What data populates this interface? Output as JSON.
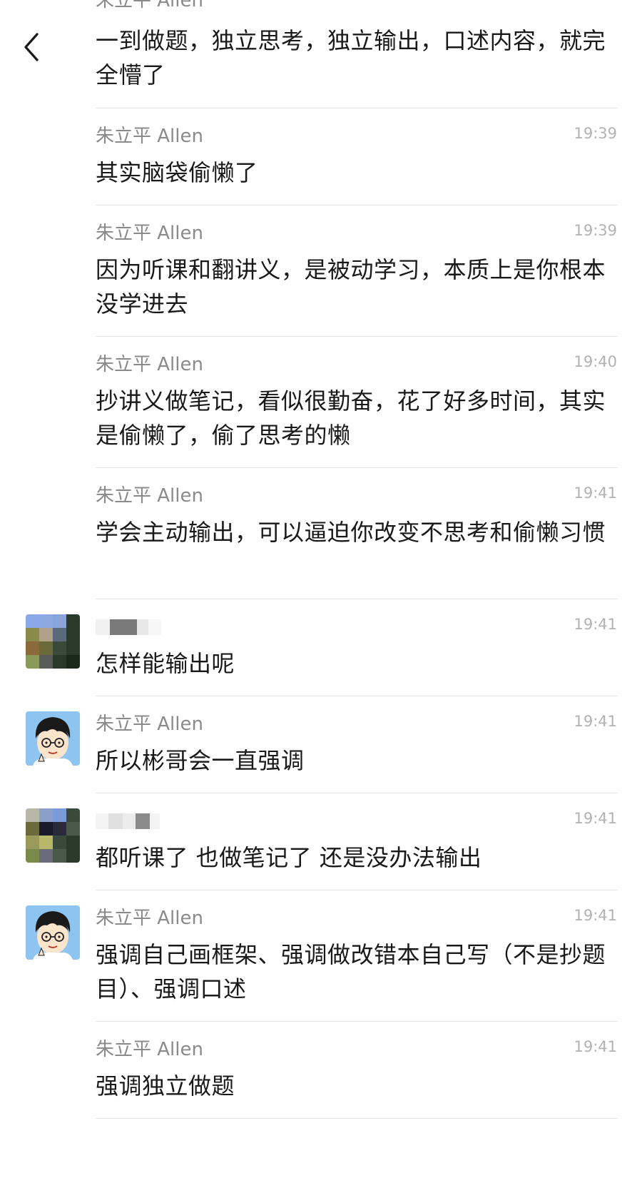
{
  "nav": {
    "back_icon": "chevron-left-icon"
  },
  "messages": [
    {
      "sender": "朱立平 Allen",
      "time": "",
      "text": "一到做题，独立思考，独立输出，口述内容，就完全懵了"
    },
    {
      "sender": "朱立平 Allen",
      "time": "19:39",
      "text": "其实脑袋偷懒了"
    },
    {
      "sender": "朱立平 Allen",
      "time": "19:39",
      "text": "因为听课和翻讲义，是被动学习，本质上是你根本没学进去"
    },
    {
      "sender": "朱立平 Allen",
      "time": "19:40",
      "text": "抄讲义做笔记，看似很勤奋，花了好多时间，其实是偷懒了，偷了思考的懒"
    },
    {
      "sender": "朱立平 Allen",
      "time": "19:41",
      "text": "学会主动输出，可以逼迫你改变不思考和偷懒习惯"
    },
    {
      "sender": "",
      "time": "19:41",
      "text": "怎样能输出呢"
    },
    {
      "sender": "朱立平 Allen",
      "time": "19:41",
      "text": "所以彬哥会一直强调"
    },
    {
      "sender": "",
      "time": "19:41",
      "text": "都听课了 也做笔记了 还是没办法输出"
    },
    {
      "sender": "朱立平 Allen",
      "time": "19:41",
      "text": "强调自己画框架、强调做改错本自己写（不是抄题目）、强调口述"
    },
    {
      "sender": "朱立平 Allen",
      "time": "19:41",
      "text": "强调独立做题"
    }
  ],
  "colors": {
    "sender_gray": "#8a8a8a",
    "time_gray": "#b2b2b2",
    "text": "#191919",
    "divider": "#e3e3e3",
    "avatar_bg": "#8ec5f0"
  }
}
